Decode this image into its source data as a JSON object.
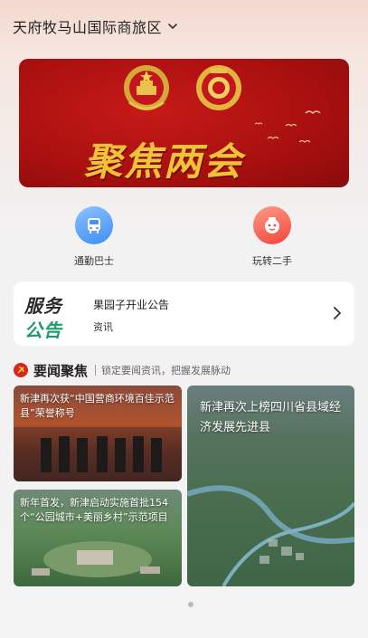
{
  "header": {
    "title": "天府牧马山国际商旅区",
    "chevron_icon": "chevron-down-icon"
  },
  "banner": {
    "text": "聚焦两会"
  },
  "quick_actions": [
    {
      "label": "通勤巴士",
      "icon": "bus-icon",
      "color": "#4a93f5"
    },
    {
      "label": "玩转二手",
      "icon": "mascot-icon",
      "color": "#f2453a"
    }
  ],
  "notice": {
    "logo_line1": "服务",
    "logo_line2": "公告",
    "title": "果园子开业公告",
    "category": "资讯"
  },
  "news_section": {
    "title": "要闻聚焦",
    "subtitle": "锁定要闻资讯，把握发展脉动",
    "items": [
      {
        "text": "新津再次获“中国营商环境百佳示范县”荣誉称号"
      },
      {
        "text": "新年首发，新津启动实施首批154个“公园城市+美丽乡村”示范项目"
      },
      {
        "text": "新津再次上榜四川省县域经济发展先进县"
      }
    ]
  },
  "pagination": {
    "total": 1,
    "current": 1
  }
}
